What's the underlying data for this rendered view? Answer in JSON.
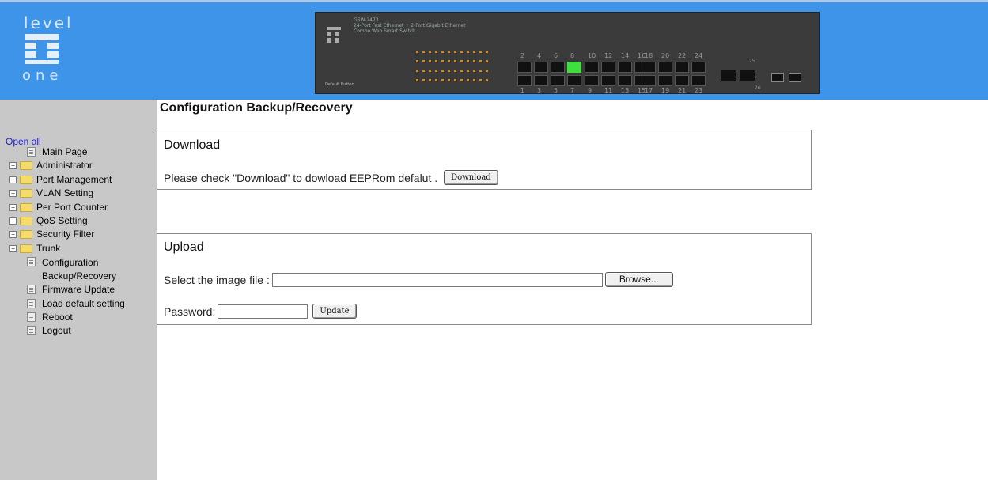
{
  "header": {
    "logo_text_top": "level",
    "logo_text_bottom": "one",
    "device_model": "GSW-2473",
    "device_desc_1": "24-Port Fast Ethernet + 2-Port Gigabit Ethernet",
    "device_desc_2": "Combo Web Smart Switch",
    "default_button_label": "Default Button",
    "top_port_numbers": [
      "2",
      "4",
      "6",
      "8",
      "10",
      "12",
      "14",
      "16",
      "18",
      "20",
      "22",
      "24"
    ],
    "bottom_port_numbers": [
      "1",
      "3",
      "5",
      "7",
      "9",
      "11",
      "13",
      "15",
      "17",
      "19",
      "21",
      "23"
    ],
    "sfp_labels": [
      "25",
      "26"
    ],
    "active_port": "8"
  },
  "sidebar": {
    "open_all": "Open all",
    "items": [
      {
        "label": "Main Page",
        "type": "page"
      },
      {
        "label": "Administrator",
        "type": "folder"
      },
      {
        "label": "Port Management",
        "type": "folder"
      },
      {
        "label": "VLAN Setting",
        "type": "folder"
      },
      {
        "label": "Per Port Counter",
        "type": "folder"
      },
      {
        "label": "QoS Setting",
        "type": "folder"
      },
      {
        "label": "Security Filter",
        "type": "folder"
      },
      {
        "label": "Trunk",
        "type": "folder"
      },
      {
        "label": "Configuration",
        "label2": "Backup/Recovery",
        "type": "page"
      },
      {
        "label": "Firmware Update",
        "type": "page"
      },
      {
        "label": "Load default setting",
        "type": "page"
      },
      {
        "label": "Reboot",
        "type": "page"
      },
      {
        "label": "Logout",
        "type": "page"
      }
    ]
  },
  "main": {
    "title": "Configuration Backup/Recovery",
    "download": {
      "heading": "Download",
      "text": "Please check \"Download\" to dowload EEPRom defalut .",
      "button": "Download"
    },
    "upload": {
      "heading": "Upload",
      "file_label": "Select the image file :",
      "file_value": "",
      "browse_button": "Browse...",
      "password_label": "Password:",
      "password_value": "",
      "update_button": "Update"
    }
  }
}
